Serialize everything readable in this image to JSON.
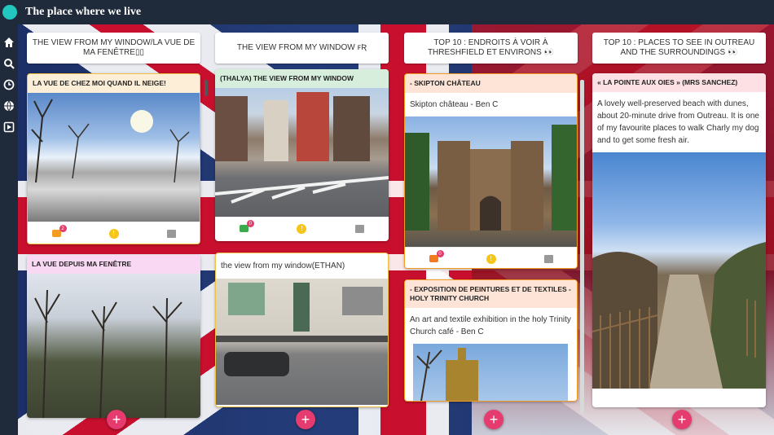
{
  "app": {
    "title": "The place where we live"
  },
  "columns": [
    {
      "header": "THE VIEW FROM MY WINDOW/LA VUE DE MA FENÊTRE▯▯",
      "cards": [
        {
          "title": "LA VUE DE CHEZ MOI QUAND IL NEIGE!",
          "comment_count": "2"
        },
        {
          "title": "LA VUE DEPUIS MA FENÊTRE"
        }
      ]
    },
    {
      "header": "THE VIEW FROM MY WINDOW ꜰʀ",
      "cards": [
        {
          "title": "(THALYA) THE VIEW FROM MY WINDOW",
          "comment_count": "0"
        },
        {
          "text": "the view from my window(ETHAN)"
        }
      ]
    },
    {
      "header": "TOP 10 : ENDROITS À VOIR À THRESHFIELD ET ENVIRONS 👀",
      "cards": [
        {
          "title": "- SKIPTON CHÂTEAU",
          "text": "Skipton château - Ben C",
          "comment_count": "0"
        },
        {
          "title": "- EXPOSITION DE PEINTURES ET DE TEXTILES - HOLY TRINITY CHURCH",
          "text": "An art and textile exhibition in the holy Trinity Church café - Ben C"
        }
      ]
    },
    {
      "header": "TOP 10 : PLACES TO SEE IN OUTREAU AND THE SURROUNDINGS 👀",
      "cards": [
        {
          "title": "« LA POINTE AUX OIES » (MRS SANCHEZ)",
          "text": "A lovely well-preserved beach with dunes, about 20-minute drive from Outreau. It is one of my favourite places to walk Charly my dog and to get some fresh air."
        }
      ]
    }
  ],
  "add_label": "+",
  "colors": {
    "accent": "#e63b6f",
    "topbar": "#1f2a3a",
    "logo": "#22c7c0"
  }
}
